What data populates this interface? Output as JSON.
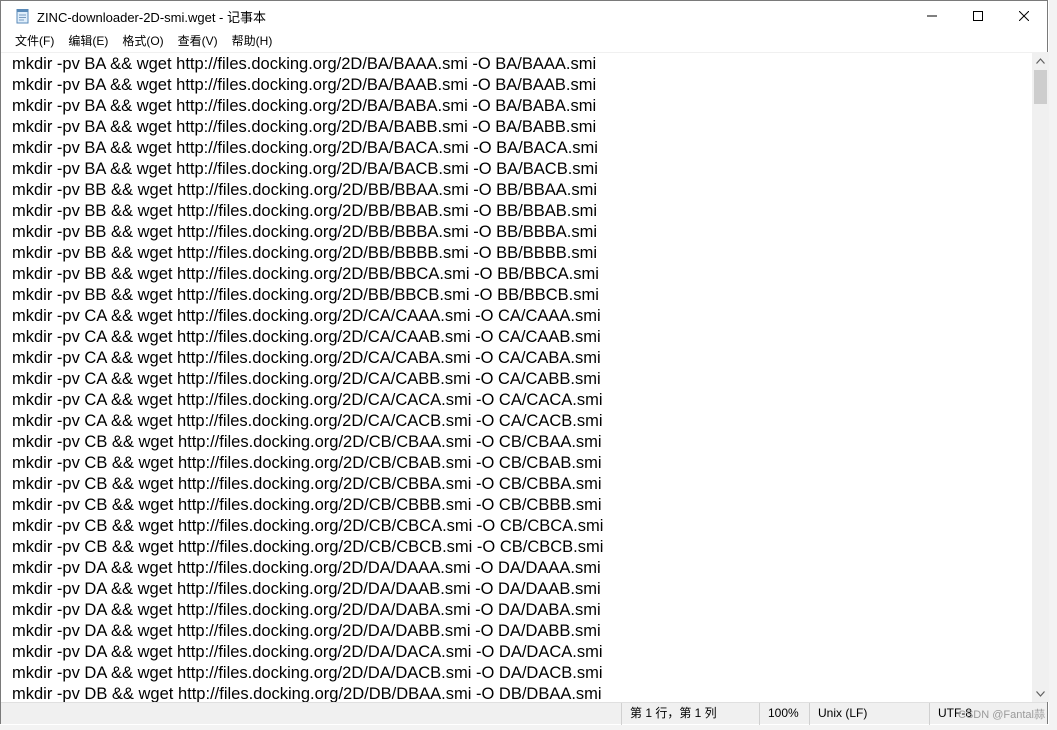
{
  "window": {
    "title": "ZINC-downloader-2D-smi.wget - 记事本",
    "icon": "notepad-icon"
  },
  "controls": {
    "minimize_icon": "minimize-icon",
    "maximize_icon": "maximize-icon",
    "close_icon": "close-icon"
  },
  "menu": [
    {
      "label": "文件(F)"
    },
    {
      "label": "编辑(E)"
    },
    {
      "label": "格式(O)"
    },
    {
      "label": "查看(V)"
    },
    {
      "label": "帮助(H)"
    }
  ],
  "editor": {
    "lines": [
      "mkdir -pv BA && wget http://files.docking.org/2D/BA/BAAA.smi -O BA/BAAA.smi",
      "mkdir -pv BA && wget http://files.docking.org/2D/BA/BAAB.smi -O BA/BAAB.smi",
      "mkdir -pv BA && wget http://files.docking.org/2D/BA/BABA.smi -O BA/BABA.smi",
      "mkdir -pv BA && wget http://files.docking.org/2D/BA/BABB.smi -O BA/BABB.smi",
      "mkdir -pv BA && wget http://files.docking.org/2D/BA/BACA.smi -O BA/BACA.smi",
      "mkdir -pv BA && wget http://files.docking.org/2D/BA/BACB.smi -O BA/BACB.smi",
      "mkdir -pv BB && wget http://files.docking.org/2D/BB/BBAA.smi -O BB/BBAA.smi",
      "mkdir -pv BB && wget http://files.docking.org/2D/BB/BBAB.smi -O BB/BBAB.smi",
      "mkdir -pv BB && wget http://files.docking.org/2D/BB/BBBA.smi -O BB/BBBA.smi",
      "mkdir -pv BB && wget http://files.docking.org/2D/BB/BBBB.smi -O BB/BBBB.smi",
      "mkdir -pv BB && wget http://files.docking.org/2D/BB/BBCA.smi -O BB/BBCA.smi",
      "mkdir -pv BB && wget http://files.docking.org/2D/BB/BBCB.smi -O BB/BBCB.smi",
      "mkdir -pv CA && wget http://files.docking.org/2D/CA/CAAA.smi -O CA/CAAA.smi",
      "mkdir -pv CA && wget http://files.docking.org/2D/CA/CAAB.smi -O CA/CAAB.smi",
      "mkdir -pv CA && wget http://files.docking.org/2D/CA/CABA.smi -O CA/CABA.smi",
      "mkdir -pv CA && wget http://files.docking.org/2D/CA/CABB.smi -O CA/CABB.smi",
      "mkdir -pv CA && wget http://files.docking.org/2D/CA/CACA.smi -O CA/CACA.smi",
      "mkdir -pv CA && wget http://files.docking.org/2D/CA/CACB.smi -O CA/CACB.smi",
      "mkdir -pv CB && wget http://files.docking.org/2D/CB/CBAA.smi -O CB/CBAA.smi",
      "mkdir -pv CB && wget http://files.docking.org/2D/CB/CBAB.smi -O CB/CBAB.smi",
      "mkdir -pv CB && wget http://files.docking.org/2D/CB/CBBA.smi -O CB/CBBA.smi",
      "mkdir -pv CB && wget http://files.docking.org/2D/CB/CBBB.smi -O CB/CBBB.smi",
      "mkdir -pv CB && wget http://files.docking.org/2D/CB/CBCA.smi -O CB/CBCA.smi",
      "mkdir -pv CB && wget http://files.docking.org/2D/CB/CBCB.smi -O CB/CBCB.smi",
      "mkdir -pv DA && wget http://files.docking.org/2D/DA/DAAA.smi -O DA/DAAA.smi",
      "mkdir -pv DA && wget http://files.docking.org/2D/DA/DAAB.smi -O DA/DAAB.smi",
      "mkdir -pv DA && wget http://files.docking.org/2D/DA/DABA.smi -O DA/DABA.smi",
      "mkdir -pv DA && wget http://files.docking.org/2D/DA/DABB.smi -O DA/DABB.smi",
      "mkdir -pv DA && wget http://files.docking.org/2D/DA/DACA.smi -O DA/DACA.smi",
      "mkdir -pv DA && wget http://files.docking.org/2D/DA/DACB.smi -O DA/DACB.smi",
      "mkdir -pv DB && wget http://files.docking.org/2D/DB/DBAA.smi -O DB/DBAA.smi"
    ]
  },
  "statusbar": {
    "position": "第 1 行，第 1 列",
    "zoom": "100%",
    "line_ending": "Unix (LF)",
    "encoding": "UTF-8"
  },
  "watermark": "CSDN @Fantal蒜"
}
